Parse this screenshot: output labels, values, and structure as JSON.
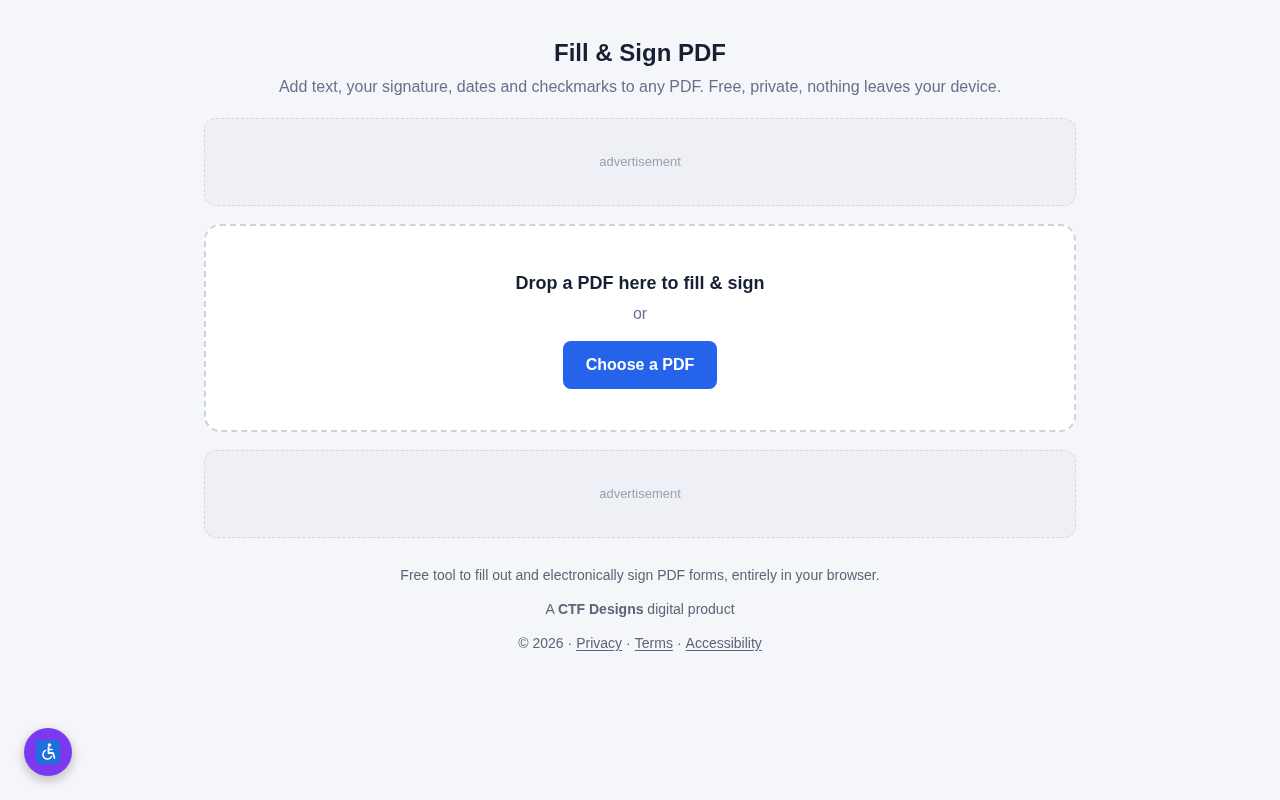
{
  "header": {
    "title": "Fill & Sign PDF",
    "subtitle": "Add text, your signature, dates and checkmarks to any PDF. Free, private, nothing leaves your device."
  },
  "ad_top": {
    "label": "advertisement"
  },
  "drop_zone": {
    "heading": "Drop a PDF here to fill & sign",
    "or": "or",
    "button": "Choose a PDF"
  },
  "ad_bottom": {
    "label": "advertisement"
  },
  "footer": {
    "description": "Free tool to fill out and electronically sign PDF forms, entirely in your browser.",
    "credit": "A **CTF Designs** digital product",
    "legal": [
      {
        "kind": "text",
        "text": "© 2026"
      },
      {
        "kind": "separator",
        "text": "·"
      },
      {
        "kind": "link",
        "text": "Privacy"
      },
      {
        "kind": "separator",
        "text": "·"
      },
      {
        "kind": "link",
        "text": "Terms"
      },
      {
        "kind": "separator",
        "text": "·"
      },
      {
        "kind": "link",
        "text": "Accessibility"
      }
    ]
  }
}
